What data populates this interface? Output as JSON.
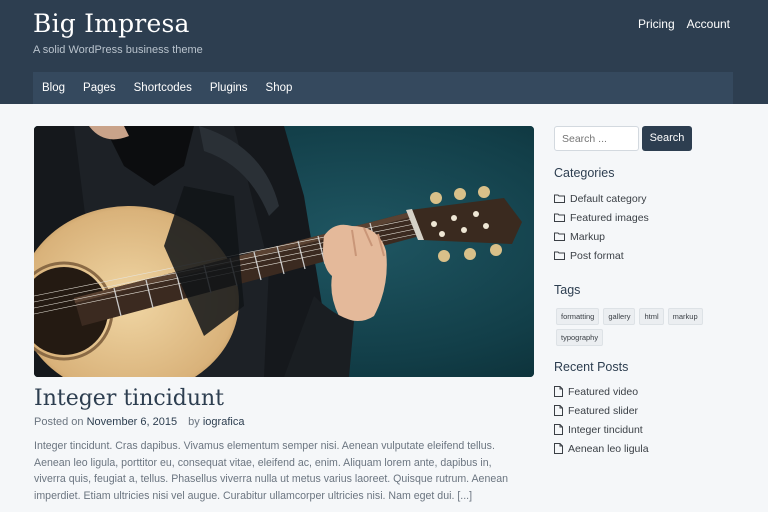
{
  "header": {
    "site_title": "Big Impresa",
    "tagline": "A solid WordPress business theme",
    "top_links": [
      "Pricing",
      "Account"
    ]
  },
  "nav": {
    "items": [
      "Blog",
      "Pages",
      "Shortcodes",
      "Plugins",
      "Shop"
    ]
  },
  "post": {
    "title": "Integer tincidunt",
    "posted_on_label": "Posted on",
    "date": "November 6, 2015",
    "by_label": "by",
    "author": "iografica",
    "excerpt": "Integer tincidunt. Cras dapibus. Vivamus elementum semper nisi. Aenean vulputate eleifend tellus. Aenean leo ligula, porttitor eu, consequat vitae, eleifend ac, enim. Aliquam lorem ante, dapibus in, viverra quis, feugiat a, tellus. Phasellus viverra nulla ut metus varius laoreet. Quisque rutrum. Aenean imperdiet. Etiam ultricies nisi vel augue. Curabitur ullamcorper ultricies nisi. Nam eget dui. [...]"
  },
  "sidebar": {
    "search": {
      "placeholder": "Search ...",
      "button": "Search"
    },
    "categories": {
      "title": "Categories",
      "items": [
        "Default category",
        "Featured images",
        "Markup",
        "Post format"
      ]
    },
    "tags": {
      "title": "Tags",
      "items": [
        "formatting",
        "gallery",
        "html",
        "markup",
        "typography"
      ]
    },
    "recent_posts": {
      "title": "Recent Posts",
      "items": [
        "Featured video",
        "Featured slider",
        "Integer tincidunt",
        "Aenean leo ligula"
      ]
    }
  },
  "colors": {
    "header_bg": "#2d3e50",
    "nav_bg": "#35495e",
    "accent": "#2d3e50",
    "page_bg": "#f5f7f9"
  },
  "icons": {
    "category_item": "folder-icon",
    "recent_post_item": "document-icon"
  }
}
